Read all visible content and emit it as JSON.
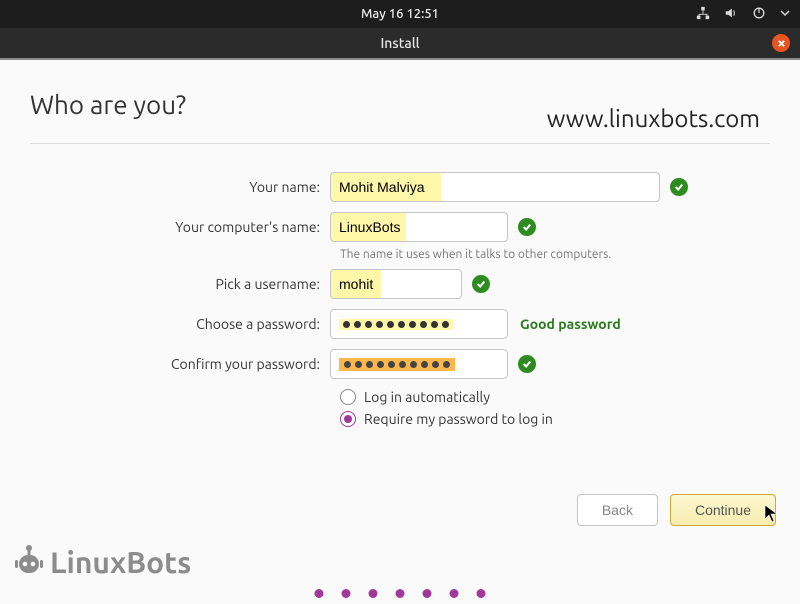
{
  "topbar": {
    "datetime": "May 16  12:51"
  },
  "window": {
    "title": "Install"
  },
  "page": {
    "heading": "Who are you?",
    "watermark_url": "www.linuxbots.com",
    "watermark_brand": "LinuxBots"
  },
  "form": {
    "name_label": "Your name:",
    "name_value": "Mohit Malviya",
    "computer_label": "Your computer's name:",
    "computer_value": "LinuxBots",
    "computer_hint": "The name it uses when it talks to other computers.",
    "username_label": "Pick a username:",
    "username_value": "mohit",
    "password_label": "Choose a password:",
    "password_strength": "Good password",
    "confirm_label": "Confirm your password:",
    "auto_login_label": "Log in automatically",
    "require_pwd_label": "Require my password to log in"
  },
  "nav": {
    "back": "Back",
    "continue": "Continue"
  },
  "colors": {
    "accent": "#a0399a",
    "ubuntu_orange": "#e95420",
    "success": "#2e8b1f"
  }
}
